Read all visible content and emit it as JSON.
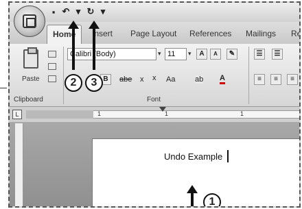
{
  "quick_access": {
    "save_icon": "save-icon",
    "undo_icon": "undo-icon",
    "redo_icon": "redo-icon",
    "customize_icon": "customize-icon",
    "save_glyph": "▪",
    "undo_glyph": "↶",
    "redo_glyph": "↻",
    "dropdown_glyph": "▾"
  },
  "tabs": [
    "Home",
    "Insert",
    "Page Layout",
    "References",
    "Mailings",
    "Re"
  ],
  "ribbon": {
    "clipboard": {
      "label": "Clipboard",
      "paste_label": "Paste"
    },
    "font": {
      "label": "Font",
      "font_name": "Calibri (Body)",
      "font_size": "11",
      "grow": "A",
      "shrink": "A",
      "clear": "✎",
      "bold": "B",
      "strike": "abe",
      "subscript": "x",
      "superscript": "x",
      "change_case": "Aa",
      "highlight": "ab",
      "font_color": "A"
    }
  },
  "callouts": {
    "one": "1",
    "two": "2",
    "three": "3"
  },
  "document": {
    "text": "Undo Example"
  },
  "ruler": {
    "marks": [
      "1",
      "1",
      "1"
    ]
  }
}
